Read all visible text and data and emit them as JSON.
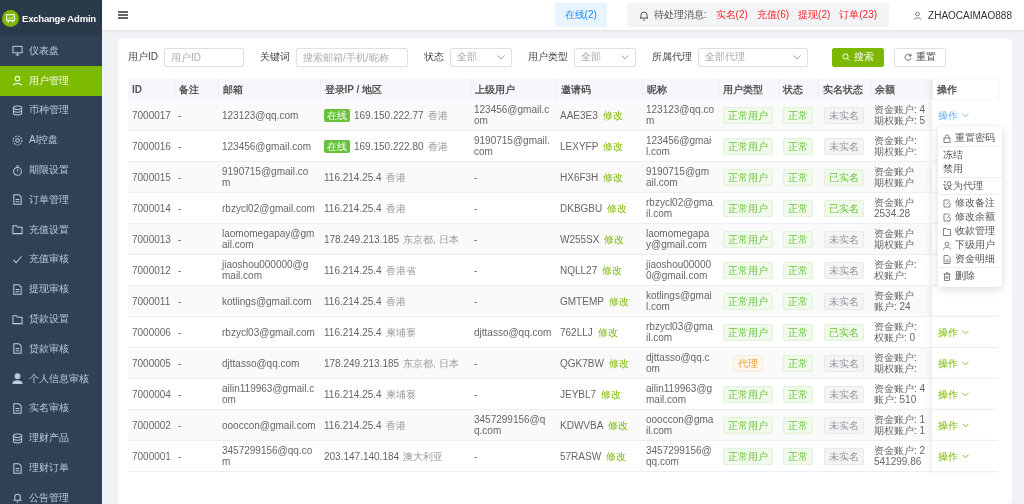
{
  "brand": {
    "title": "Exchange Admin"
  },
  "sidebar": {
    "items": [
      {
        "label": "仪表盘",
        "selected": false
      },
      {
        "label": "用户管理",
        "selected": true
      },
      {
        "label": "币种管理",
        "selected": false
      },
      {
        "label": "AI控盘",
        "selected": false
      },
      {
        "label": "期限设置",
        "selected": false
      },
      {
        "label": "订单管理",
        "selected": false
      },
      {
        "label": "充值设置",
        "selected": false
      },
      {
        "label": "充值审核",
        "selected": false
      },
      {
        "label": "提现审核",
        "selected": false
      },
      {
        "label": "贷款设置",
        "selected": false
      },
      {
        "label": "贷款审核",
        "selected": false
      },
      {
        "label": "个人信息审核",
        "selected": false
      },
      {
        "label": "实名审核",
        "selected": false
      },
      {
        "label": "理财产品",
        "selected": false
      },
      {
        "label": "理财订单",
        "selected": false
      },
      {
        "label": "公告管理",
        "selected": false
      }
    ]
  },
  "topbar": {
    "online": "在线(2)",
    "pending_label": "待处理消息:",
    "pending": [
      "实名(2)",
      "充值(6)",
      "提现(2)",
      "订单(23)"
    ],
    "user": "ZHAOCAIMAO888"
  },
  "filters": [
    {
      "kind": "input",
      "label": "用户ID",
      "placeholder": "用户ID"
    },
    {
      "kind": "input",
      "label": "关键词",
      "placeholder": "搜索邮箱/手机/昵称"
    },
    {
      "kind": "select",
      "label": "状态",
      "placeholder": "全部"
    },
    {
      "kind": "select",
      "label": "用户类型",
      "placeholder": "全部"
    },
    {
      "kind": "select",
      "label": "所属代理",
      "placeholder": "全部代理"
    }
  ],
  "buttons": {
    "search": "搜索",
    "reset": "重置"
  },
  "table": {
    "columns": [
      "ID",
      "备注",
      "邮箱",
      "登录IP / 地区",
      "上级用户",
      "邀请码",
      "昵称",
      "用户类型",
      "状态",
      "实名状态",
      "余额",
      "操作"
    ],
    "rows": [
      {
        "id": "7000017",
        "remark": "-",
        "email": "123123@qq.com",
        "online": "在线",
        "ip": "169.150.222.77",
        "region": "香港",
        "parent": "123456@gmail.com",
        "code": "AAE3E3",
        "edit": "修改",
        "nickname": "123123@qq.com",
        "type": {
          "label": "正常用户",
          "kind": "normal"
        },
        "status": "正常",
        "real": {
          "label": "未实名",
          "verified": false
        },
        "balance": [
          "资金账户: 4",
          "期权账户: 5"
        ],
        "action": "操作",
        "active": true
      },
      {
        "id": "7000016",
        "remark": "-",
        "email": "123456@gmail.com",
        "online": "在线",
        "ip": "169.150.222.80",
        "region": "香港",
        "parent": "9190715@gmail.com",
        "code": "LEXYFP",
        "edit": "修改",
        "nickname": "123456@gmail.com",
        "type": {
          "label": "正常用户",
          "kind": "normal"
        },
        "status": "正常",
        "real": {
          "label": "未实名",
          "verified": false
        },
        "balance": [
          "资金账户:",
          "期权账户:"
        ]
      },
      {
        "id": "7000015",
        "remark": "-",
        "email": "9190715@gmail.com",
        "ip": "116.214.25.4",
        "region": "香港",
        "parent": "-",
        "code": "HX6F3H",
        "edit": "修改",
        "nickname": "9190715@gmail.com",
        "type": {
          "label": "正常用户",
          "kind": "normal"
        },
        "status": "正常",
        "real": {
          "label": "已实名",
          "verified": true
        },
        "balance": [
          "资金账户",
          "期权账户"
        ]
      },
      {
        "id": "7000014",
        "remark": "-",
        "email": "rbzycl02@gmail.com",
        "ip": "116.214.25.4",
        "region": "香港",
        "parent": "-",
        "code": "DKBGBU",
        "edit": "修改",
        "nickname": "rbzycl02@gmail.com",
        "type": {
          "label": "正常用户",
          "kind": "normal"
        },
        "status": "正常",
        "real": {
          "label": "已实名",
          "verified": true
        },
        "balance": [
          "资金账户",
          "2534.28"
        ]
      },
      {
        "id": "7000013",
        "remark": "-",
        "email": "laomomegapay@gmail.com",
        "ip": "178.249.213.185",
        "region": "东京都, 日本",
        "parent": "-",
        "code": "W255SX",
        "edit": "修改",
        "nickname": "laomomegapay@gmail.com",
        "type": {
          "label": "正常用户",
          "kind": "normal"
        },
        "status": "正常",
        "real": {
          "label": "未实名",
          "verified": false
        },
        "balance": [
          "资金账户",
          "期权账户"
        ]
      },
      {
        "id": "7000012",
        "remark": "-",
        "email": "jiaoshou000000@gmail.com",
        "ip": "116.214.25.4",
        "region": "香港省",
        "parent": "-",
        "code": "NQLL27",
        "edit": "修改",
        "nickname": "jiaoshou000000@gmail.com",
        "type": {
          "label": "正常用户",
          "kind": "normal"
        },
        "status": "正常",
        "real": {
          "label": "未实名",
          "verified": false
        },
        "balance": [
          "资金账户:",
          "权账户:"
        ]
      },
      {
        "id": "7000011",
        "remark": "-",
        "email": "kotlings@gmail.com",
        "ip": "116.214.25.4",
        "region": "香港",
        "parent": "-",
        "code": "GMTEMP",
        "edit": "修改",
        "nickname": "kotlings@gmail.com",
        "type": {
          "label": "正常用户",
          "kind": "normal"
        },
        "status": "正常",
        "real": {
          "label": "未实名",
          "verified": false
        },
        "balance": [
          "资金账户",
          "账户: 24"
        ]
      },
      {
        "id": "7000006",
        "remark": "-",
        "email": "rbzycl03@gmail.com",
        "ip": "116.214.25.4",
        "region": "柬埔寨",
        "parent": "djttasso@qq.com",
        "code": "762LLJ",
        "edit": "修改",
        "nickname": "rbzycl03@gmail.com",
        "type": {
          "label": "正常用户",
          "kind": "normal"
        },
        "status": "正常",
        "real": {
          "label": "已实名",
          "verified": true
        },
        "balance": [
          "资金账户:",
          "权账户: 0"
        ],
        "action": "操作",
        "active": false
      },
      {
        "id": "7000005",
        "remark": "-",
        "email": "djttasso@qq.com",
        "ip": "178.249.213.185",
        "region": "东京都, 日本",
        "parent": "-",
        "code": "QGK7BW",
        "edit": "修改",
        "nickname": "djttasso@qq.com",
        "type": {
          "label": "代理",
          "kind": "agent"
        },
        "status": "正常",
        "real": {
          "label": "未实名",
          "verified": false
        },
        "balance": [
          "资金账户:",
          "期权账户:"
        ],
        "action": "操作",
        "active": false
      },
      {
        "id": "7000004",
        "remark": "-",
        "email": "ailin119963@gmail.com",
        "ip": "116.214.25.4",
        "region": "柬埔寨",
        "parent": "-",
        "code": "JEYBL7",
        "edit": "修改",
        "nickname": "ailin119963@gmail.com",
        "type": {
          "label": "正常用户",
          "kind": "normal"
        },
        "status": "正常",
        "real": {
          "label": "未实名",
          "verified": false
        },
        "balance": [
          "资金账户: 4",
          "账户: 510"
        ],
        "action": "操作",
        "active": false
      },
      {
        "id": "7000002",
        "remark": "-",
        "email": "oooccon@gmail.com",
        "ip": "116.214.25.4",
        "region": "香港",
        "parent": "3457299156@qq.com",
        "code": "KDWVBA",
        "edit": "修改",
        "nickname": "oooccon@gmail.com",
        "type": {
          "label": "正常用户",
          "kind": "normal"
        },
        "status": "正常",
        "real": {
          "label": "未实名",
          "verified": false
        },
        "balance": [
          "资金账户: 1",
          "期权账户: 1"
        ],
        "action": "操作",
        "active": false
      },
      {
        "id": "7000001",
        "remark": "-",
        "email": "3457299156@qq.com",
        "ip": "203.147.140.184",
        "region": "澳大利亚",
        "parent": "-",
        "code": "57RASW",
        "edit": "修改",
        "nickname": "3457299156@qq.com",
        "type": {
          "label": "正常用户",
          "kind": "normal"
        },
        "status": "正常",
        "real": {
          "label": "未实名",
          "verified": false
        },
        "balance": [
          "资金账户: 2",
          "541299.86"
        ],
        "action": "操作",
        "active": false
      }
    ]
  },
  "menu": {
    "groups": [
      [
        "重置密码"
      ],
      [
        "冻结",
        "禁用"
      ],
      [
        "设为代理"
      ],
      [
        "修改备注",
        "修改余额",
        "收款管理",
        "下级用户",
        "资金明细"
      ],
      [
        "删除"
      ]
    ]
  }
}
